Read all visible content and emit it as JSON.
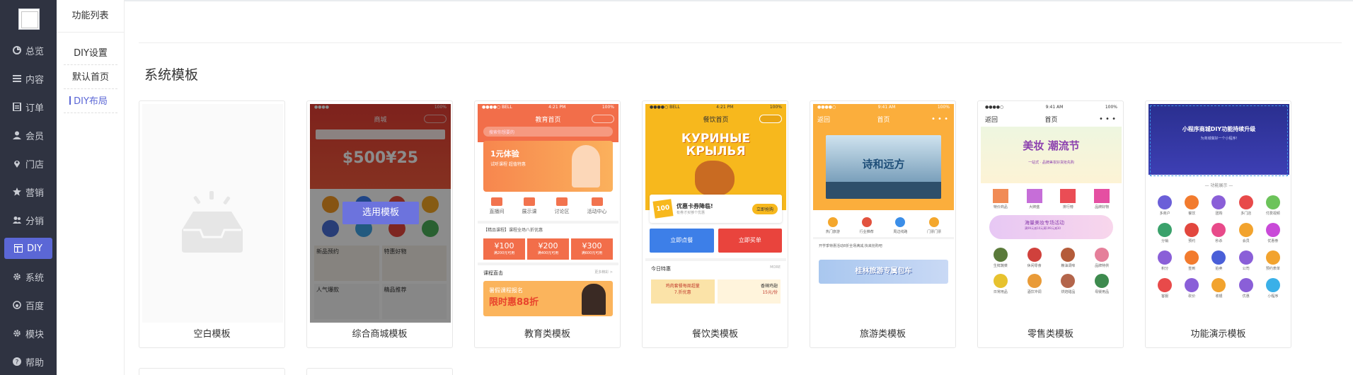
{
  "sidebar": {
    "items": [
      {
        "label": "总览",
        "icon": "pie-chart-icon"
      },
      {
        "label": "内容",
        "icon": "list-icon"
      },
      {
        "label": "订单",
        "icon": "document-icon"
      },
      {
        "label": "会员",
        "icon": "user-icon"
      },
      {
        "label": "门店",
        "icon": "location-pin-icon"
      },
      {
        "label": "营销",
        "icon": "star-icon"
      },
      {
        "label": "分销",
        "icon": "users-icon"
      },
      {
        "label": "DIY",
        "icon": "layout-icon"
      },
      {
        "label": "系统",
        "icon": "gear-icon"
      },
      {
        "label": "百度",
        "icon": "baidu-icon"
      },
      {
        "label": "模块",
        "icon": "module-gear-icon"
      },
      {
        "label": "帮助",
        "icon": "help-icon"
      }
    ],
    "active_index": 7
  },
  "subsidebar": {
    "title": "功能列表",
    "items": [
      {
        "label": "DIY设置"
      },
      {
        "label": "默认首页"
      },
      {
        "label": "DIY布局"
      }
    ],
    "active_index": 2
  },
  "main": {
    "section_title": "系统模板",
    "select_button": "选用模板",
    "templates": [
      {
        "name": "空白模板"
      },
      {
        "name": "综合商城模板"
      },
      {
        "name": "教育类模板"
      },
      {
        "name": "餐饮类模板"
      },
      {
        "name": "旅游类模板"
      },
      {
        "name": "零售类模板"
      },
      {
        "name": "功能演示模板"
      }
    ],
    "thumbs": {
      "mall": {
        "title": "商城",
        "banner_price": "$500¥25",
        "labels": [
          "新品预约",
          "特惠好物",
          "人气爆款",
          "精品推荐"
        ]
      },
      "edu": {
        "status_left": "●●●●○ BELL",
        "status_time": "4:21 PM",
        "status_right": "100%",
        "title": "教育首页",
        "search": "搜索你想要的",
        "banner_line1": "1元体验",
        "banner_line2": "试听课程 超值特惠",
        "icons": [
          "直播间",
          "展示课",
          "讨论区",
          "活动中心"
        ],
        "notice": "【精品课程】课程全场八折优惠",
        "coupons": [
          {
            "value": "¥100",
            "cond": "满200元可用"
          },
          {
            "value": "¥200",
            "cond": "满400元可用"
          },
          {
            "value": "¥300",
            "cond": "满600元可用"
          }
        ],
        "course_header": "课程直击",
        "course_more": "更多精彩 >",
        "promo_line1": "暑假课程报名",
        "promo_line2": "限时惠88折"
      },
      "food": {
        "status_left": "●●●●○ BELL",
        "status_time": "4:21 PM",
        "status_right": "100%",
        "title": "餐饮首页",
        "hero_text": "КУРИНЫЕ КРЫЛЬЯ",
        "coupon_amount": "100",
        "coupon_title": "优惠卡券降临!",
        "coupon_sub": "有券才买够个优惠",
        "coupon_btn": "立即抢购",
        "btn_left": "立即点餐",
        "btn_right": "立即买单",
        "today": "今日特惠",
        "more": "MORE",
        "dish1": "鸡肉套餐每周超量",
        "dish1_price": "7.折优惠",
        "dish2": "香辣鸡翅",
        "dish2_price": "15元/份"
      },
      "travel": {
        "status_left": "●●●●○",
        "status_time": "9:41 AM",
        "status_right": "100%",
        "back": "返回",
        "title": "首页",
        "banner": "诗和远方",
        "icons": [
          "热门旅游",
          "行业推荐",
          "周边线路",
          "门票门票"
        ],
        "notice": "开学季特惠活动8折全场满减,快来抢购吧",
        "bus": "桂林旅游专属包车"
      },
      "retail": {
        "status_left": "●●●●○",
        "status_time": "9:41 AM",
        "status_right": "100%",
        "back": "返回",
        "title": "首页",
        "banner": "美妆 潮流节",
        "banner_sub": "一站式 · 品牌美妆好货抢先购",
        "icons1": [
          "特价商品",
          "大牌盛",
          "排行榜",
          "品牌好物"
        ],
        "promo": "海量美妆专场活动",
        "promo_sub": "满99元减10元满199元减30",
        "icons2": [
          "生鲜蔬菜",
          "休闲零食",
          "粮油调味",
          "品牌特供",
          "日常用品",
          "酒饮冲调",
          "烘焙甜品",
          "母婴用品"
        ]
      },
      "demo": {
        "title_line": "小程序商城DIY功能持续升级",
        "sub_line": "为商城做好一个小程序!",
        "section": "功能展示",
        "icons": [
          "多商户",
          "餐饮",
          "团购",
          "多门店",
          "付费视频",
          "分销",
          "预约",
          "秒杀",
          "会员",
          "优惠券",
          "积分",
          "签到",
          "拍卖",
          "公司",
          "预约表单",
          "客服",
          "砍价",
          "收银",
          "优惠",
          "小程序"
        ]
      }
    }
  }
}
